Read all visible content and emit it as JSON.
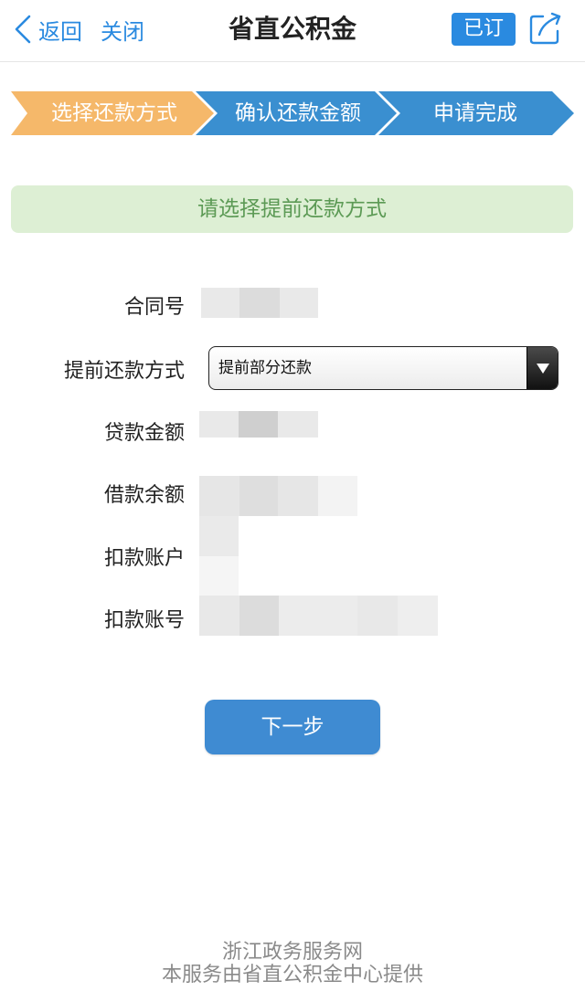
{
  "header": {
    "back_label": "返回",
    "close_label": "关闭",
    "title": "省直公积金",
    "subscribed_label": "已订"
  },
  "steps": [
    {
      "label": "选择还款方式",
      "state": "active",
      "color": "#f5b86a"
    },
    {
      "label": "确认还款金额",
      "state": "pending",
      "color": "#3a8fd0"
    },
    {
      "label": "申请完成",
      "state": "pending",
      "color": "#3a8fd0"
    }
  ],
  "notice": "请选择提前还款方式",
  "form": {
    "contract_label": "合同号",
    "repay_method_label": "提前还款方式",
    "repay_method_value": "提前部分还款",
    "loan_amount_label": "贷款金额",
    "loan_balance_label": "借款余额",
    "debit_account_label": "扣款账户",
    "debit_account_no_label": "扣款账号"
  },
  "next_label": "下一步",
  "footer": {
    "line1": "浙江政务服务网",
    "line2": "本服务由省直公积金中心提供"
  },
  "colors": {
    "accent": "#2a8ae0",
    "step_active": "#f5b86a",
    "step_pending": "#3a8fd0",
    "notice_bg": "#ddefd4",
    "notice_text": "#5c9a55",
    "button": "#3f8bd2"
  }
}
